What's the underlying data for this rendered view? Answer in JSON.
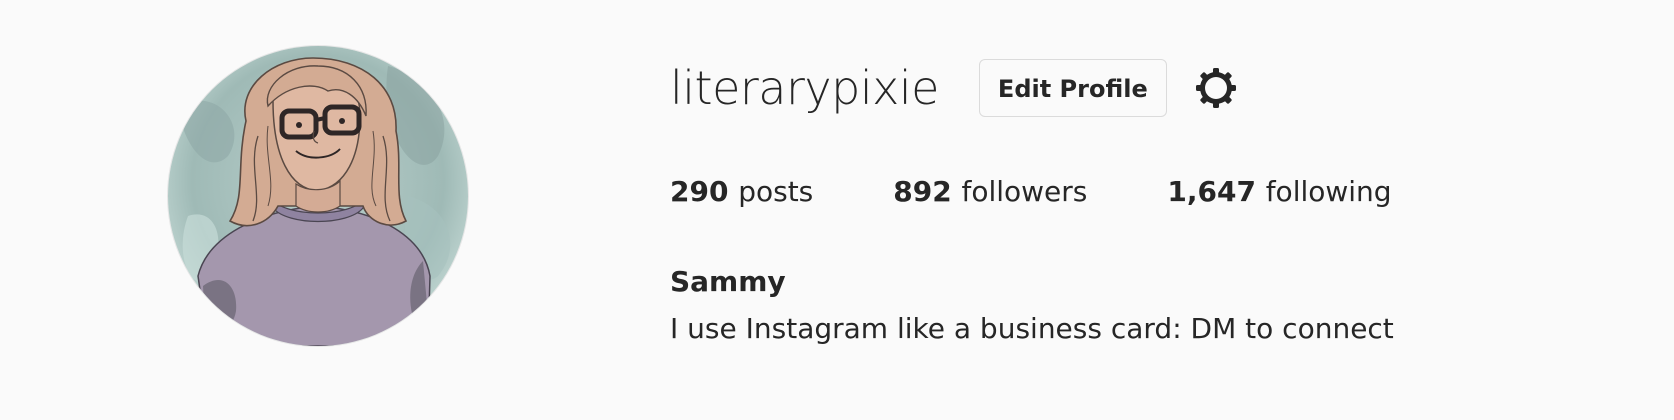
{
  "profile": {
    "username": "literarypixie",
    "edit_profile_label": "Edit Profile",
    "settings_icon": "gear-icon",
    "avatar_description_icon": "avatar-illustration"
  },
  "stats": [
    {
      "count": "290",
      "label": "posts"
    },
    {
      "count": "892",
      "label": "followers"
    },
    {
      "count": "1,647",
      "label": "following"
    }
  ],
  "bio": {
    "name": "Sammy",
    "text": "I use Instagram like a business card: DM to connect"
  },
  "colors": {
    "background": "#fafafa",
    "text": "#262626",
    "button_border": "#dbdbdb"
  }
}
